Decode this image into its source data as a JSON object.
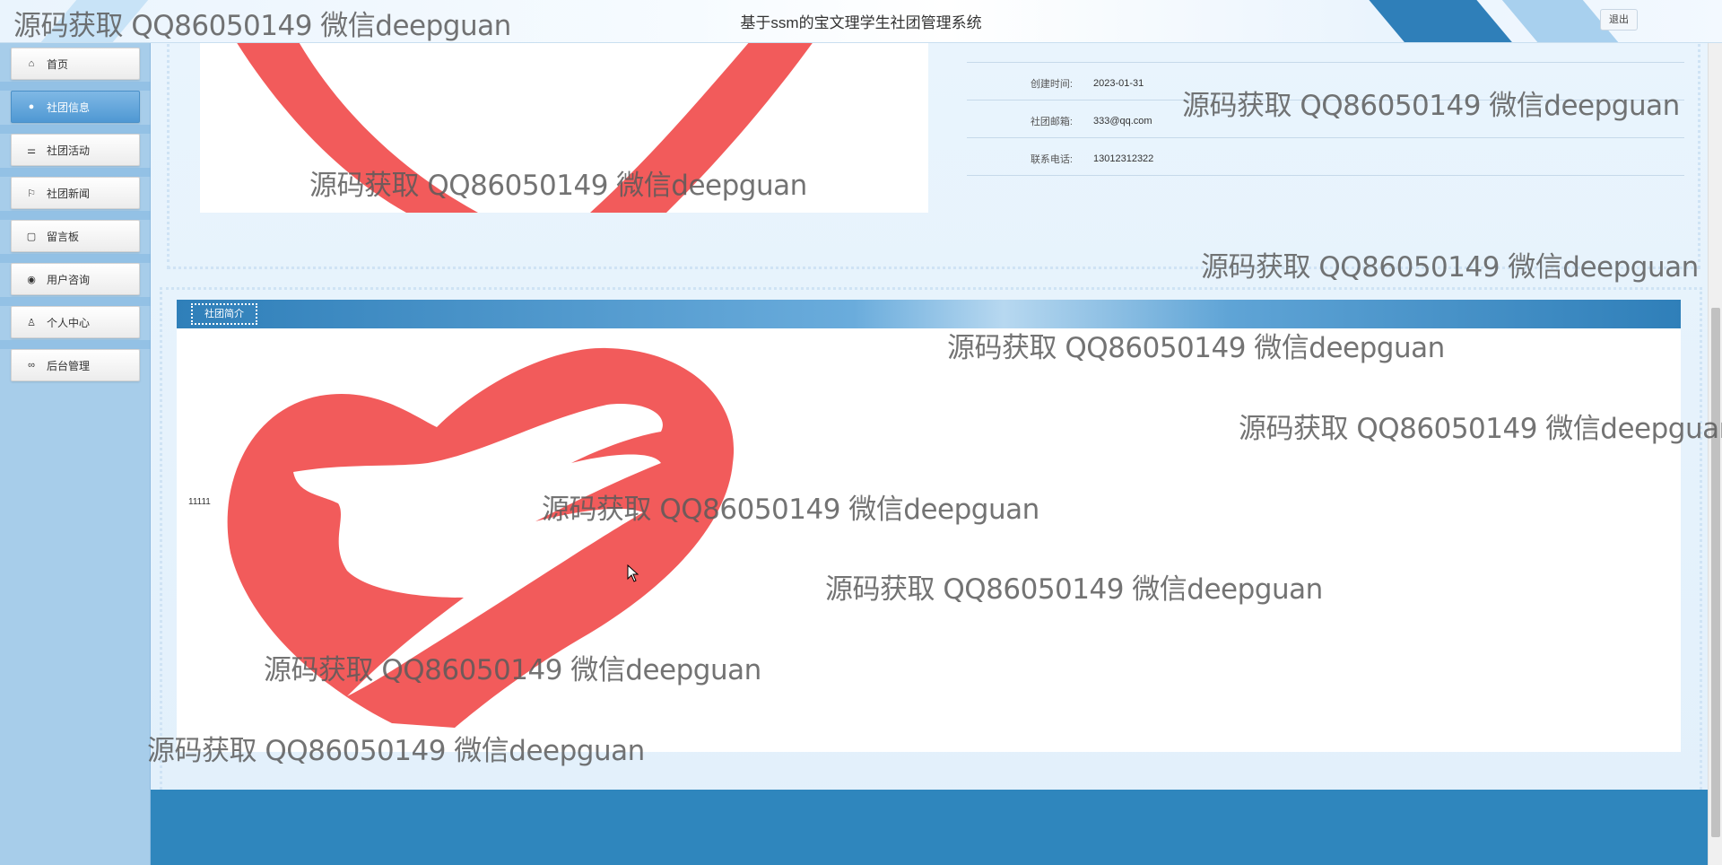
{
  "header": {
    "title": "基于ssm的宝文理学生社团管理系统",
    "logout_label": "退出"
  },
  "sidebar": {
    "items": [
      {
        "label": "首页",
        "icon": "home-icon",
        "glyph": "⌂"
      },
      {
        "label": "社团信息",
        "icon": "circle-dot-icon",
        "glyph": "●"
      },
      {
        "label": "社团活动",
        "icon": "sliders-icon",
        "glyph": "⚌"
      },
      {
        "label": "社团新闻",
        "icon": "flag-icon",
        "glyph": "⚐"
      },
      {
        "label": "留言板",
        "icon": "note-icon",
        "glyph": "▢"
      },
      {
        "label": "用户咨询",
        "icon": "chat-icon",
        "glyph": "◉"
      },
      {
        "label": "个人中心",
        "icon": "user-icon",
        "glyph": "♙"
      },
      {
        "label": "后台管理",
        "icon": "link-icon",
        "glyph": "∞"
      }
    ],
    "active_index": 1
  },
  "detail": {
    "fields": [
      {
        "label": "创建时间:",
        "value": "2023-01-31"
      },
      {
        "label": "社团邮箱:",
        "value": "333@qq.com"
      },
      {
        "label": "联系电话:",
        "value": "13012312322"
      }
    ]
  },
  "intro": {
    "tab_label": "社团简介",
    "text": "11111"
  },
  "watermark": {
    "text": "源码获取 QQ86050149 微信deepguan"
  },
  "colors": {
    "accent": "#2f7fb9",
    "sidebar": "#a7cdea",
    "logo_red": "#f25b5b"
  }
}
